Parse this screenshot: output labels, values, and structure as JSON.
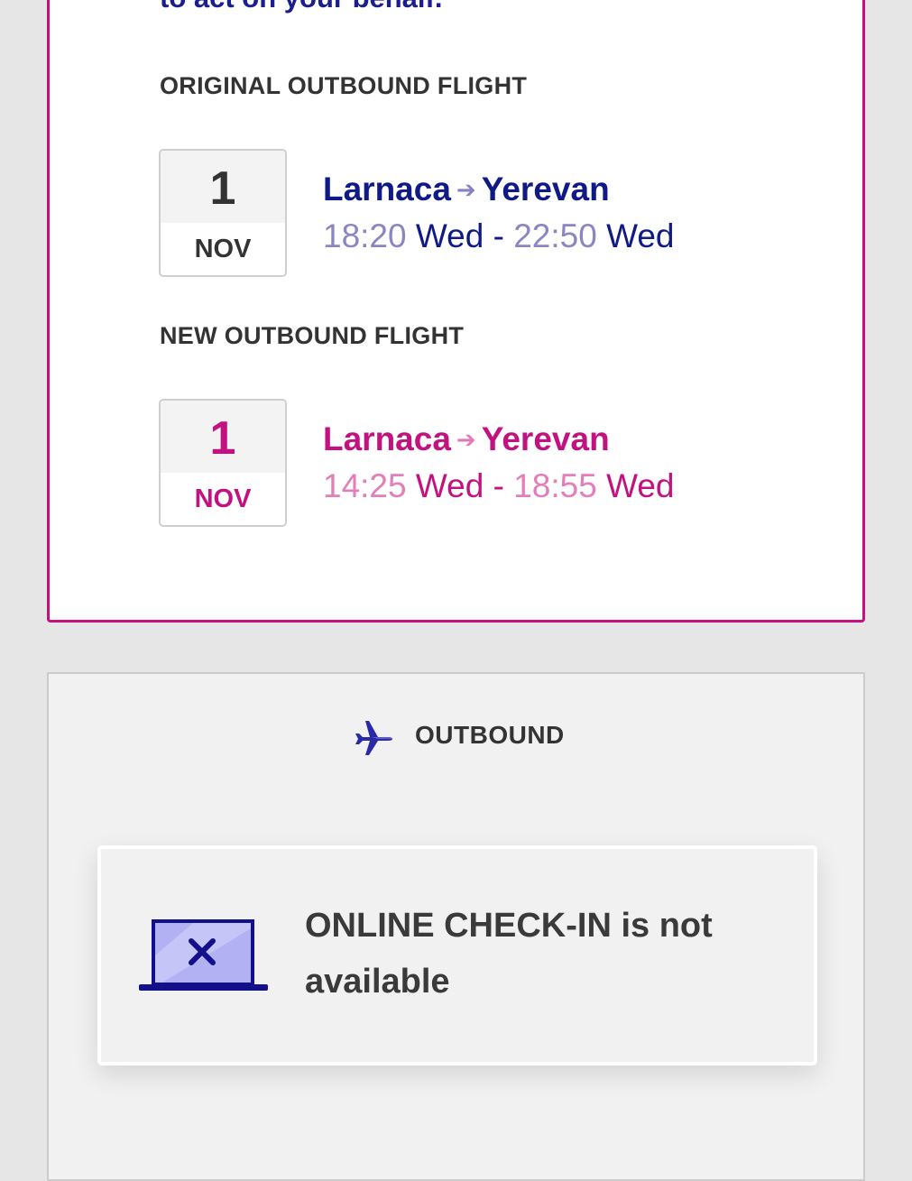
{
  "intro": {
    "text": "to act on your behalf."
  },
  "original_flight": {
    "section_label": "ORIGINAL OUTBOUND FLIGHT",
    "day": "1",
    "month": "NOV",
    "from": "Larnaca",
    "to": "Yerevan",
    "depart_time": "18:20",
    "depart_day": "Wed",
    "arrive_time": "22:50",
    "arrive_day": "Wed",
    "separator": "-"
  },
  "new_flight": {
    "section_label": "NEW OUTBOUND FLIGHT",
    "day": "1",
    "month": "NOV",
    "from": "Larnaca",
    "to": "Yerevan",
    "depart_time": "14:25",
    "depart_day": "Wed",
    "arrive_time": "18:55",
    "arrive_day": "Wed",
    "separator": "-"
  },
  "outbound": {
    "label": "OUTBOUND",
    "icon": "airplane-icon",
    "checkin_message": "ONLINE CHECK-IN is not available",
    "checkin_icon": "laptop-unavailable-icon"
  },
  "colors": {
    "brand_magenta": "#c3127f",
    "brand_navy": "#0f1a87",
    "laptop_fill": "#b2b1f3"
  }
}
